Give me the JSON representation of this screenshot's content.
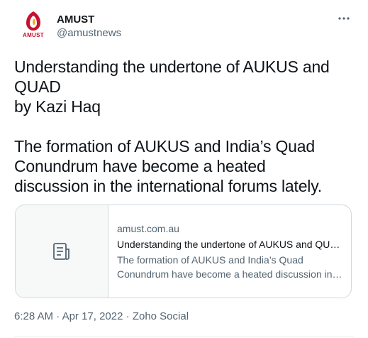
{
  "author": {
    "avatar_text": "AMUST",
    "display_name": "AMUST",
    "handle": "@amustnews"
  },
  "menu": {
    "icon": "more-horizontal-icon"
  },
  "tweet": {
    "lines": [
      "Understanding the undertone of AUKUS and",
      "QUAD",
      "by Kazi Haq",
      "The formation of AUKUS and India’s Quad",
      "Conundrum have become a heated",
      "discussion in the international forums lately."
    ]
  },
  "card": {
    "icon": "article-icon",
    "domain": "amust.com.au",
    "title": "Understanding the undertone of AUKUS and QUAD",
    "description_lines": [
      "The formation of AUKUS and India’s Quad",
      "Conundrum have become a heated discussion in the international forums lately."
    ]
  },
  "meta": {
    "time": "6:28 AM",
    "separator": "·",
    "date": "Apr 17, 2022",
    "source": "Zoho Social"
  },
  "colors": {
    "brand": "#c8102e",
    "accent": "#f5a623",
    "text_primary": "#0f1419",
    "text_secondary": "#536471",
    "border": "#cfd9de"
  }
}
